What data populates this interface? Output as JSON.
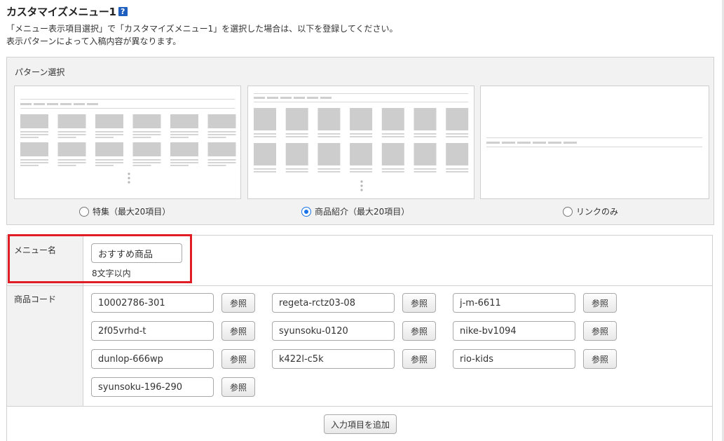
{
  "header": {
    "title": "カスタマイズメニュー1",
    "help_icon": "?",
    "desc_line1": "「メニュー表示項目選択」で「カスタマイズメニュー1」を選択した場合は、以下を登録してください。",
    "desc_line2": "表示パターンによって入稿内容が異なります。"
  },
  "pattern": {
    "label": "パターン選択",
    "options": [
      {
        "label": "特集（最大20項目）",
        "selected": false
      },
      {
        "label": "商品紹介（最大20項目）",
        "selected": true
      },
      {
        "label": "リンクのみ",
        "selected": false
      }
    ]
  },
  "menu_name": {
    "label": "メニュー名",
    "value": "おすすめ商品",
    "hint": "8文字以内"
  },
  "product_codes": {
    "label": "商品コード",
    "browse_label": "参照",
    "codes": [
      "10002786-301",
      "regeta-rctz03-08",
      "j-m-6611",
      "2f05vrhd-t",
      "syunsoku-0120",
      "nike-bv1094",
      "dunlop-666wp",
      "k422l-c5k",
      "rio-kids",
      "syunsoku-196-290"
    ]
  },
  "add_item_label": "入力項目を追加",
  "colors": {
    "highlight": "#e01c24",
    "radio_selected": "#1a73e8",
    "help_icon": "#1f5fbf"
  }
}
